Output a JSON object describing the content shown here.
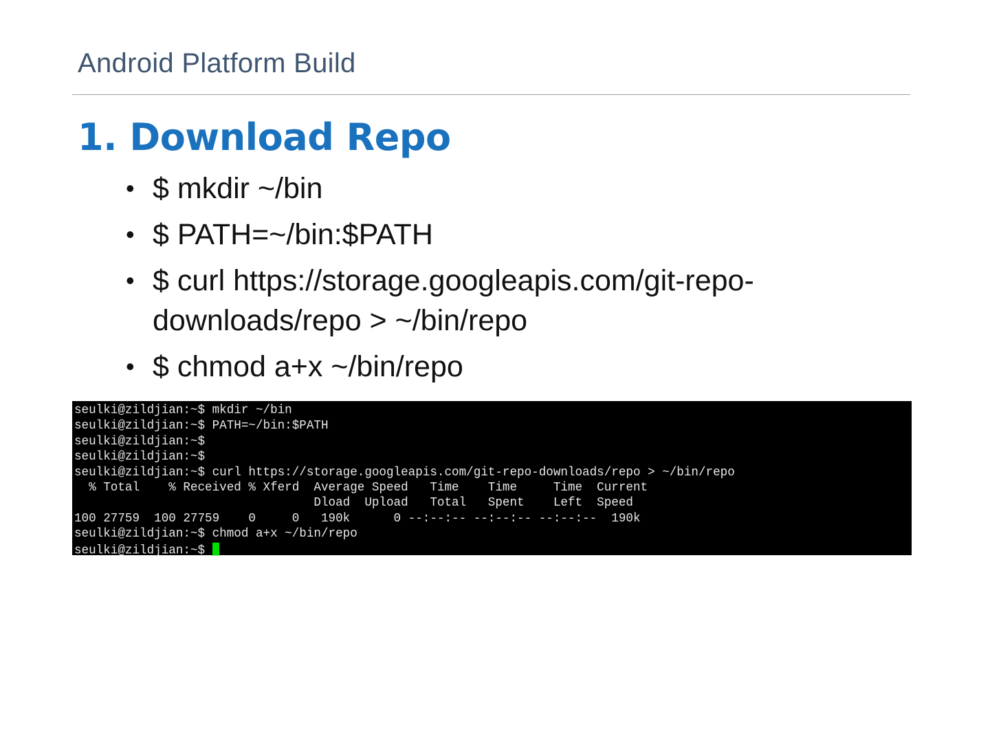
{
  "header": {
    "title": "Android Platform Build"
  },
  "section": {
    "title": "1. Download Repo"
  },
  "bullets": [
    "$ mkdir ~/bin",
    "$ PATH=~/bin:$PATH",
    "$ curl https://storage.googleapis.com/git-repo-downloads/repo > ~/bin/repo",
    "$ chmod a+x ~/bin/repo"
  ],
  "terminal": {
    "lines": [
      "seulki@zildjian:~$ mkdir ~/bin",
      "seulki@zildjian:~$ PATH=~/bin:$PATH",
      "seulki@zildjian:~$",
      "seulki@zildjian:~$",
      "seulki@zildjian:~$ curl https://storage.googleapis.com/git-repo-downloads/repo > ~/bin/repo",
      "  % Total    % Received % Xferd  Average Speed   Time    Time     Time  Current",
      "                                 Dload  Upload   Total   Spent    Left  Speed",
      "100 27759  100 27759    0     0   190k      0 --:--:-- --:--:-- --:--:--  190k",
      "seulki@zildjian:~$ chmod a+x ~/bin/repo"
    ],
    "prompt": "seulki@zildjian:~$ ",
    "cursor_color": "#00e000"
  }
}
